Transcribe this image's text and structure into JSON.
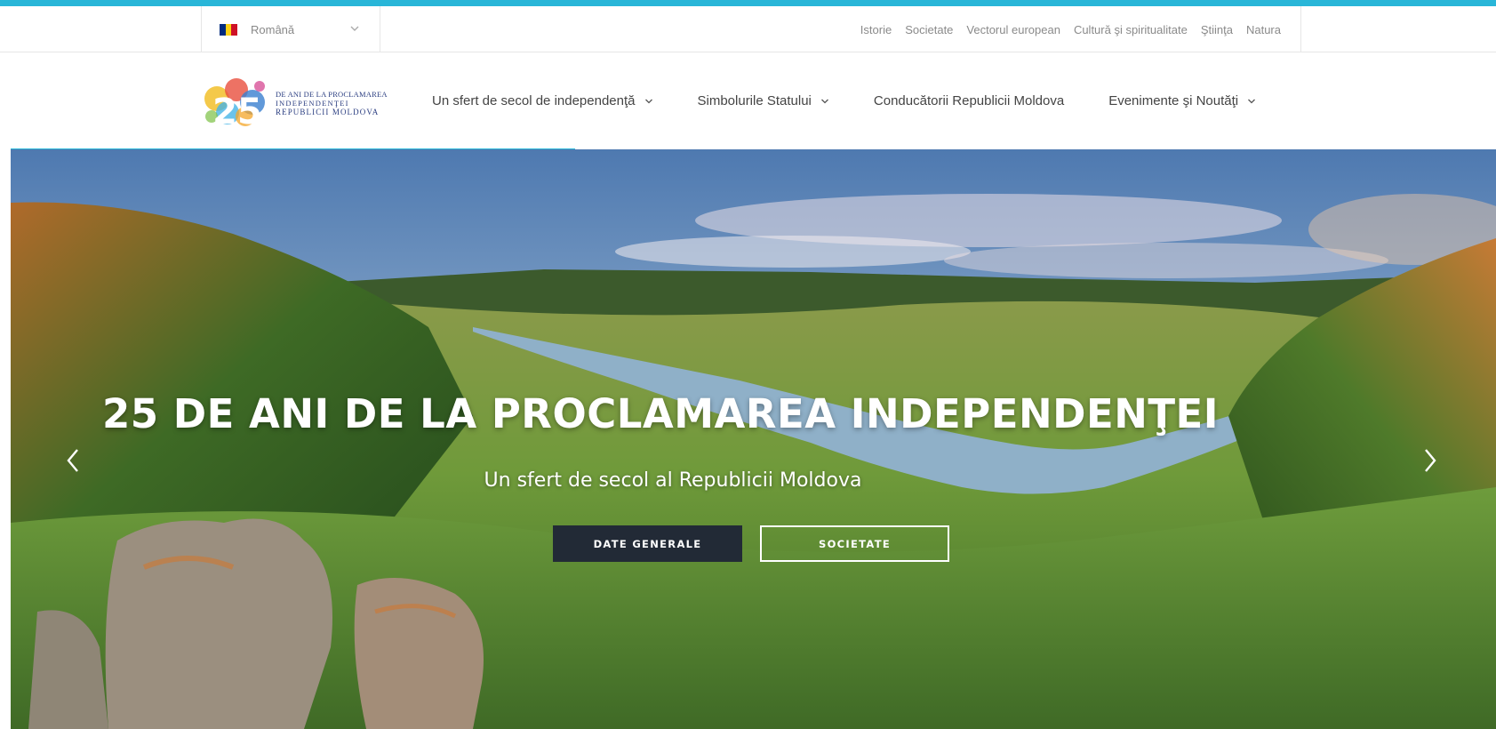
{
  "language": {
    "selected": "Română",
    "flag_colors": [
      "#002b7f",
      "#fcd116",
      "#ce1126"
    ]
  },
  "utility_nav": [
    "Istorie",
    "Societate",
    "Vectorul european",
    "Cultură şi spiritualitate",
    "Ştiinţa",
    "Natura"
  ],
  "logo": {
    "number": "25",
    "line1": "DE ANI DE LA PROCLAMAREA",
    "line2": "INDEPENDENŢEI",
    "line3": "REPUBLICII MOLDOVA"
  },
  "main_nav": [
    {
      "label": "Un sfert de secol de independenţă",
      "has_dropdown": true
    },
    {
      "label": "Simbolurile Statului",
      "has_dropdown": true
    },
    {
      "label": "Conducătorii Republicii Moldova",
      "has_dropdown": false
    },
    {
      "label": "Evenimente şi Noutăţi",
      "has_dropdown": true
    }
  ],
  "hero": {
    "title": "25 DE ANI DE LA PROCLAMAREA INDEPENDENŢEI",
    "subtitle": "Un sfert de secol al Republicii Moldova",
    "primary_button": "DATE GENERALE",
    "secondary_button": "SOCIETATE",
    "slide_progress": 0.38
  },
  "colors": {
    "accent": "#29b6d8",
    "primary_button_bg": "#222a36",
    "logo_text": "#2a3d80"
  },
  "icons": [
    "chevron-down-icon",
    "arrow-left-icon",
    "arrow-right-icon"
  ]
}
